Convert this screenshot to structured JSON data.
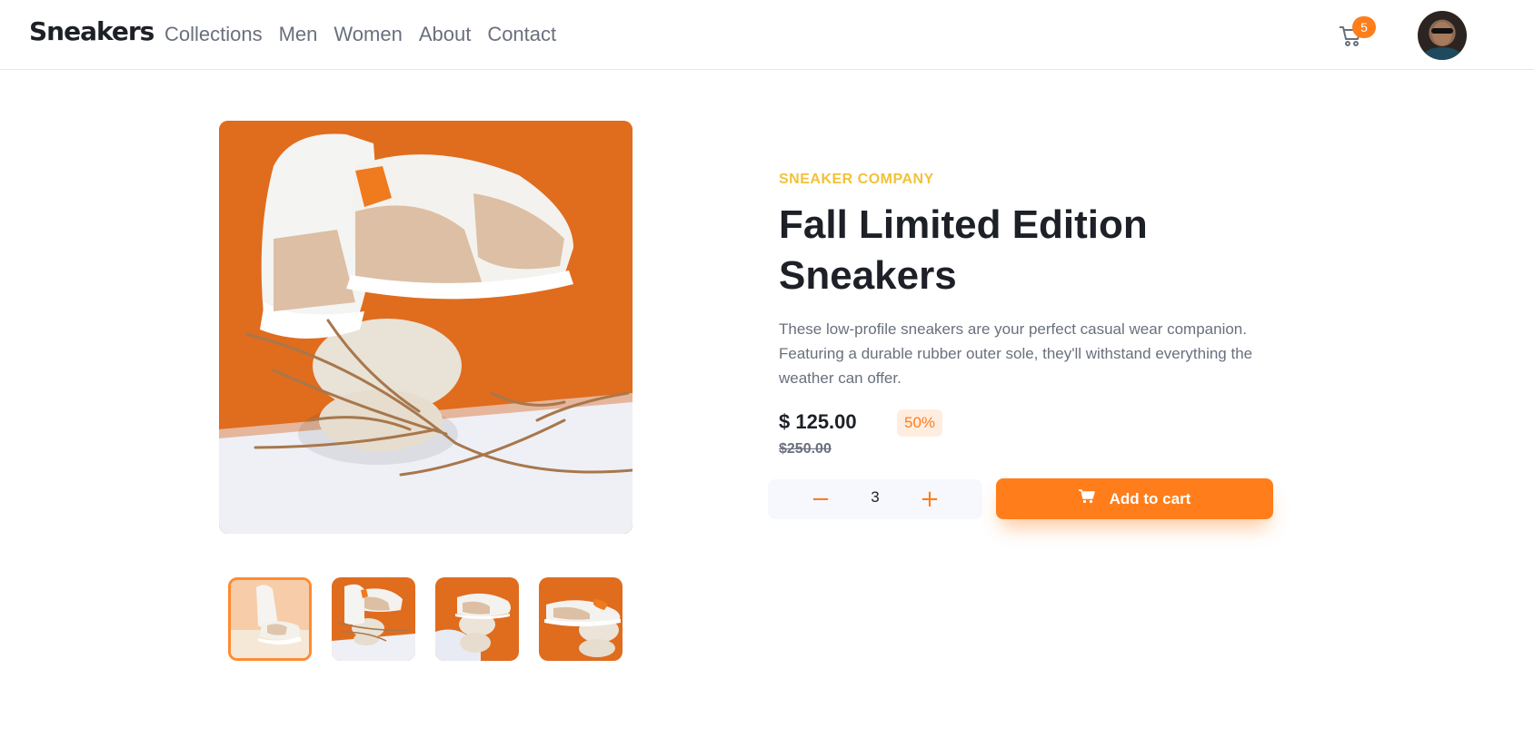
{
  "header": {
    "logo": "Sneakers",
    "nav": [
      "Collections",
      "Men",
      "Women",
      "About",
      "Contact"
    ],
    "cart_count": "5"
  },
  "product": {
    "company": "SNEAKER COMPANY",
    "title": "Fall Limited Edition Sneakers",
    "description": "These low-profile sneakers are your perfect casual wear companion. Featuring a durable rubber outer sole, they'll withstand everything the weather can offer.",
    "price": "$ 125.00",
    "discount": "50%",
    "original_price": "$250.00",
    "quantity": "3",
    "add_to_cart_label": "Add to cart"
  },
  "gallery": {
    "thumbnails": 4,
    "active_thumbnail": 1
  },
  "colors": {
    "accent": "#ff7e1b",
    "company": "#f2c13a",
    "text_dark": "#1d2026",
    "text_muted": "#69707d"
  }
}
